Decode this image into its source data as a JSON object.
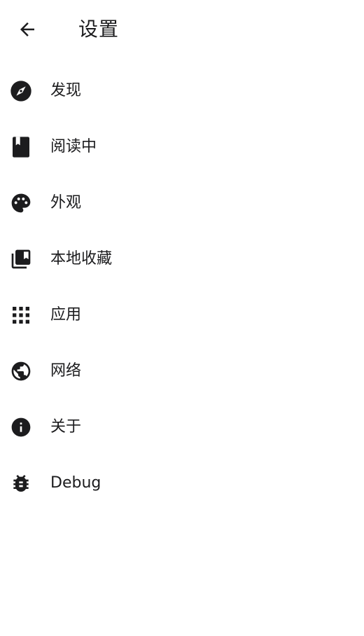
{
  "app_bar": {
    "title": "设置",
    "back_icon": "arrow-back-icon"
  },
  "menu": {
    "items": [
      {
        "label": "发现",
        "icon": "compass-icon"
      },
      {
        "label": "阅读中",
        "icon": "book-icon"
      },
      {
        "label": "外观",
        "icon": "palette-icon"
      },
      {
        "label": "本地收藏",
        "icon": "collections-bookmark-icon"
      },
      {
        "label": "应用",
        "icon": "apps-grid-icon"
      },
      {
        "label": "网络",
        "icon": "globe-icon"
      },
      {
        "label": "关于",
        "icon": "info-icon"
      },
      {
        "label": "Debug",
        "icon": "bug-icon"
      }
    ]
  },
  "colors": {
    "icon": "#1c1c1e",
    "background": "#ffffff"
  }
}
